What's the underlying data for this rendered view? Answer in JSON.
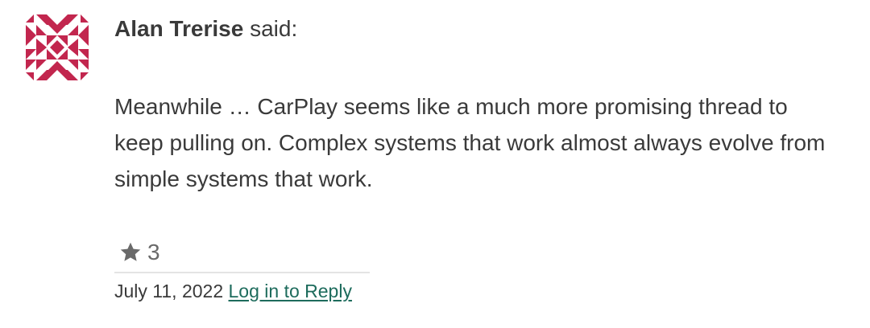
{
  "comment": {
    "author": "Alan Trerise",
    "said": "said:",
    "body": "Meanwhile … CarPlay seems like a much more promising thread to keep pulling on. Complex systems that work almost always evolve from simple systems that work.",
    "rating": {
      "icon": "star-icon",
      "count": "3"
    },
    "date": "July 11, 2022",
    "reply_label": "Log in to Reply",
    "avatar": {
      "icon": "quilt-pattern-avatar",
      "color": "#c2264e"
    }
  },
  "colors": {
    "text": "#3a3a3a",
    "link": "#1d6b5c",
    "star": "#6a6a6a",
    "divider": "#e4e4e4"
  }
}
